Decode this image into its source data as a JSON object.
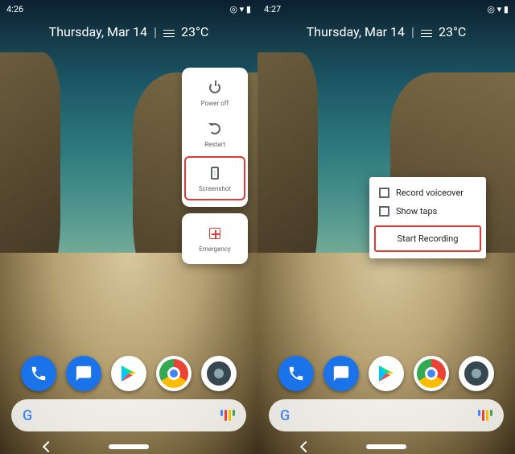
{
  "left": {
    "status": {
      "time": "4:26",
      "icons": [
        "app",
        "app",
        "sync",
        "wifi",
        "battery"
      ]
    },
    "date": "Thursday, Mar 14",
    "temp": "23°C",
    "power_menu": {
      "items": [
        {
          "label": "Power off",
          "icon": "power-icon",
          "highlighted": false
        },
        {
          "label": "Restart",
          "icon": "restart-icon",
          "highlighted": false
        },
        {
          "label": "Screenshot",
          "icon": "screenshot-icon",
          "highlighted": true
        }
      ],
      "emergency": {
        "label": "Emergency",
        "icon": "emergency-icon"
      }
    }
  },
  "right": {
    "status": {
      "time": "4:27",
      "icons": [
        "app",
        "app",
        "sync",
        "wifi",
        "battery"
      ]
    },
    "date": "Thursday, Mar 14",
    "temp": "23°C",
    "record_menu": {
      "options": [
        {
          "label": "Record voiceover",
          "checked": false
        },
        {
          "label": "Show taps",
          "checked": false
        }
      ],
      "start_label": "Start Recording"
    }
  },
  "colors": {
    "highlight": "#e53935",
    "google_g": [
      "#4285f4",
      "#ea4335",
      "#fbbc04",
      "#34a853"
    ]
  }
}
